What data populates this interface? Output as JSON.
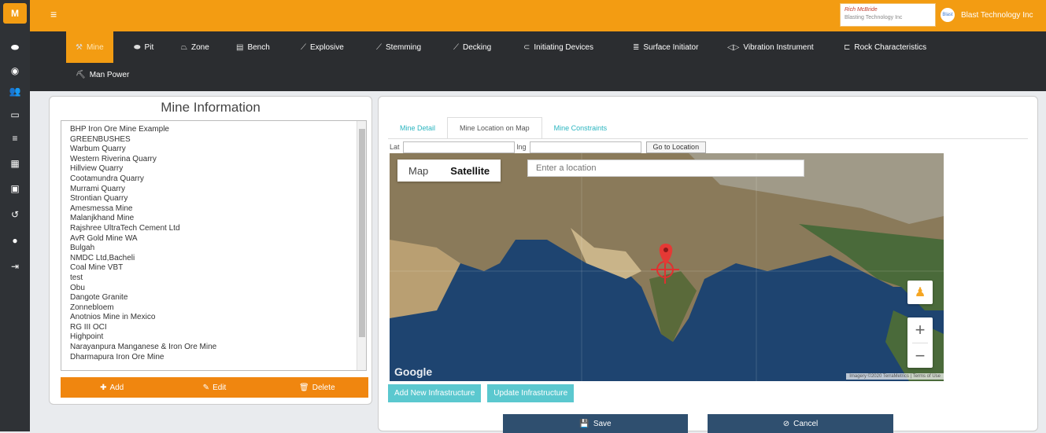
{
  "header": {
    "user_name": "Rich McBride",
    "user_company": "Blasting Technology Inc",
    "company_logo_text": "Blast",
    "company_name": "Blast Technology Inc"
  },
  "menu": {
    "items": [
      {
        "label": "Mine",
        "icon": "mine-icon",
        "active": true
      },
      {
        "label": "Pit",
        "icon": "pit-icon"
      },
      {
        "label": "Zone",
        "icon": "zone-icon"
      },
      {
        "label": "Bench",
        "icon": "bench-icon"
      },
      {
        "label": "Explosive",
        "icon": "explosive-icon"
      },
      {
        "label": "Stemming",
        "icon": "stemming-icon"
      },
      {
        "label": "Decking",
        "icon": "decking-icon"
      },
      {
        "label": "Initiating Devices",
        "icon": "initiating-devices-icon"
      },
      {
        "label": "Surface Initiator",
        "icon": "surface-initiator-icon"
      },
      {
        "label": "Vibration Instrument",
        "icon": "vibration-instrument-icon"
      },
      {
        "label": "Rock Characteristics",
        "icon": "rock-characteristics-icon"
      },
      {
        "label": "Man Power",
        "icon": "man-power-icon"
      }
    ]
  },
  "mine_info": {
    "title": "Mine Information",
    "mines": [
      "BHP Iron Ore Mine Example",
      "GREENBUSHES",
      "Warbum Quarry",
      "Western Riverina Quarry",
      "Hillview Quarry",
      "Cootamundra Quarry",
      "Murrami Quarry",
      "Strontian Quarry",
      "Amesmessa Mine",
      "Malanjkhand Mine",
      "Rajshree UltraTech Cement Ltd",
      "AvR Gold Mine WA",
      "Bulgah",
      "NMDC Ltd,Bacheli",
      "Coal Mine VBT",
      "test",
      "Obu",
      "Dangote Granite",
      "Zonnebloem",
      "Anotnios Mine in Mexico",
      "RG III OCI",
      "Highpoint",
      "Narayanpura Manganese & Iron Ore Mine",
      "Dharmapura Iron Ore Mine"
    ],
    "add_label": "Add",
    "edit_label": "Edit",
    "delete_label": "Delete"
  },
  "detail": {
    "tabs": [
      {
        "label": "Mine Detail",
        "active": false
      },
      {
        "label": "Mine Location on Map",
        "active": true
      },
      {
        "label": "Mine Constraints",
        "active": false
      }
    ],
    "lat_label": "Lat",
    "lat_value": "",
    "lng_label": "lng",
    "lng_value": "",
    "go_label": "Go to Location",
    "map": {
      "type_map": "Map",
      "type_satellite": "Satellite",
      "search_placeholder": "Enter a location",
      "google": "Google",
      "attribution": "Imagery ©2020 TerraMetrics | Terms of Use"
    },
    "add_infra_label": "Add New Infrastructure",
    "update_infra_label": "Update Infrastructure",
    "save_label": "Save",
    "cancel_label": "Cancel"
  },
  "colors": {
    "accent": "#f39c12",
    "menu_bg": "#2b2d30",
    "teal": "#5bc8cf",
    "save_bg": "#2f4f6f"
  }
}
